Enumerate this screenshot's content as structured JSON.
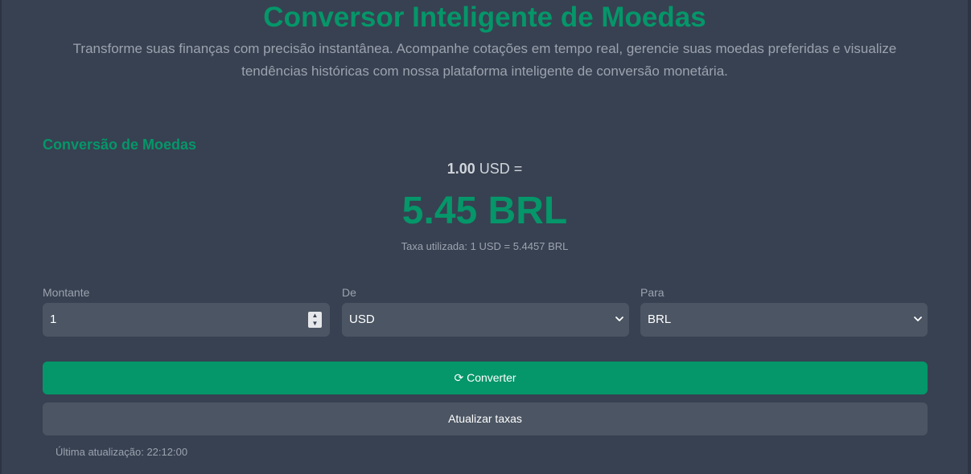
{
  "header": {
    "title": "Conversor Inteligente de Moedas",
    "subtitle": "Transforme suas finanças com precisão instantânea. Acompanhe cotações em tempo real, gerencie suas moedas preferidas e visualize tendências históricas com nossa plataforma inteligente de conversão monetária."
  },
  "converter": {
    "section_title": "Conversão de Moedas",
    "amount_number": "1.00",
    "amount_suffix": "USD =",
    "result": "5.45 BRL",
    "rate_used": "Taxa utilizada: 1 USD = 5.4457 BRL"
  },
  "form": {
    "amount_label": "Montante",
    "amount_value": "1",
    "from_label": "De",
    "from_value": "USD",
    "to_label": "Para",
    "to_value": "BRL"
  },
  "buttons": {
    "convert_icon": "⟳",
    "convert_label": "Converter",
    "update_rates_label": "Atualizar taxas"
  },
  "status": {
    "last_update": "Última atualização: 22:12:00"
  },
  "icons": {
    "convert": "refresh-icon",
    "dropdown": "chevron-down-icon",
    "stepper": "number-stepper-icon"
  },
  "colors": {
    "accent": "#059669",
    "background": "#374151",
    "field": "#4b5563",
    "muted_text": "#9ca3af"
  }
}
